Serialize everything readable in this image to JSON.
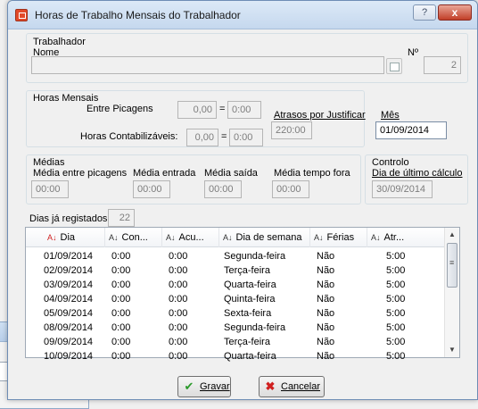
{
  "background_window": {
    "help_label": "?",
    "close_label": "x"
  },
  "window": {
    "title": "Horas de Trabalho Mensais do Trabalhador",
    "help_label": "?",
    "close_label": "x"
  },
  "trabalhador": {
    "group_label": "Trabalhador",
    "nome_label": "Nome",
    "nome_value": "",
    "num_label": "Nº",
    "num_value": "2"
  },
  "horas_mensais": {
    "group_label": "Horas Mensais",
    "entre_label": "Entre Picagens",
    "entre_value1": "0,00",
    "entre_eq": "=",
    "entre_value2": "0:00",
    "contab_label": "Horas Contabilizáveis:",
    "contab_value1": "0,00",
    "contab_eq": "=",
    "contab_value2": "0:00",
    "atrasos_label": "Atrasos por Justificar",
    "atrasos_value": "220:00",
    "mes_label": "Mês",
    "mes_value": "01/09/2014"
  },
  "medias": {
    "group_label": "Médias",
    "entre_label": "Média entre picagens",
    "entre_value": "00:00",
    "entrada_label": "Média entrada",
    "entrada_value": "00:00",
    "saida_label": "Média saída",
    "saida_value": "00:00",
    "tempo_label": "Média tempo fora",
    "tempo_value": "00:00"
  },
  "controlo": {
    "group_label": "Controlo",
    "ultimo_label": "Dia de último cálculo",
    "ultimo_value": "30/09/2014"
  },
  "dias": {
    "label": "Dias já registados:",
    "value": "22"
  },
  "table": {
    "columns": [
      "Dia",
      "Con...",
      "Acu...",
      "Dia de semana",
      "Férias",
      "Atr..."
    ],
    "rows": [
      [
        "01/09/2014",
        "0:00",
        "0:00",
        "Segunda-feira",
        "Não",
        "5:00"
      ],
      [
        "02/09/2014",
        "0:00",
        "0:00",
        "Terça-feira",
        "Não",
        "5:00"
      ],
      [
        "03/09/2014",
        "0:00",
        "0:00",
        "Quarta-feira",
        "Não",
        "5:00"
      ],
      [
        "04/09/2014",
        "0:00",
        "0:00",
        "Quinta-feira",
        "Não",
        "5:00"
      ],
      [
        "05/09/2014",
        "0:00",
        "0:00",
        "Sexta-feira",
        "Não",
        "5:00"
      ],
      [
        "08/09/2014",
        "0:00",
        "0:00",
        "Segunda-feira",
        "Não",
        "5:00"
      ],
      [
        "09/09/2014",
        "0:00",
        "0:00",
        "Terça-feira",
        "Não",
        "5:00"
      ],
      [
        "10/09/2014",
        "0:00",
        "0:00",
        "Quarta-feira",
        "Não",
        "5:00"
      ]
    ]
  },
  "buttons": {
    "gravar": "Gravar",
    "cancelar": "Cancelar"
  },
  "colors": {
    "sort_active": "#d02020",
    "close_button": "#c13f28"
  },
  "icons": {
    "sort": "sort-az-icon",
    "lookup": "lookup-icon",
    "gravar": "checkmark-icon",
    "cancelar": "red-x-icon"
  }
}
